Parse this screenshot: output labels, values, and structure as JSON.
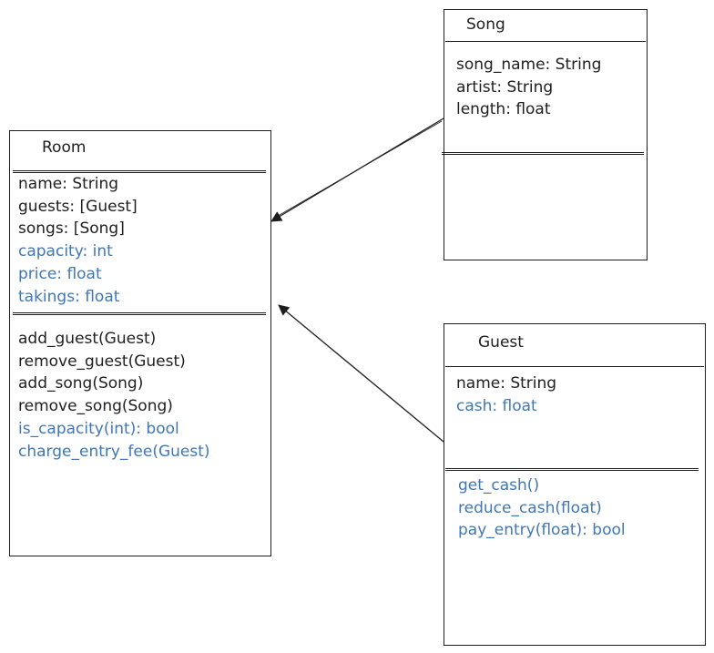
{
  "colors": {
    "ink": "#1e1e1e",
    "accent_blue": "#3f77b4",
    "background": "#ffffff"
  },
  "classes": {
    "room": {
      "title": "Room",
      "attributes": [
        {
          "text": "name: String",
          "color": "black"
        },
        {
          "text": "guests: [Guest]",
          "color": "black"
        },
        {
          "text": "songs: [Song]",
          "color": "black"
        },
        {
          "text": "capacity: int",
          "color": "blue"
        },
        {
          "text": "price: float",
          "color": "blue"
        },
        {
          "text": "takings: float",
          "color": "blue"
        }
      ],
      "methods": [
        {
          "text": "add_guest(Guest)",
          "color": "black"
        },
        {
          "text": "remove_guest(Guest)",
          "color": "black"
        },
        {
          "text": "add_song(Song)",
          "color": "black"
        },
        {
          "text": "remove_song(Song)",
          "color": "black"
        },
        {
          "text": "is_capacity(int): bool",
          "color": "blue"
        },
        {
          "text": "charge_entry_fee(Guest)",
          "color": "blue"
        }
      ]
    },
    "song": {
      "title": "Song",
      "attributes": [
        {
          "text": "song_name: String",
          "color": "black"
        },
        {
          "text": "artist: String",
          "color": "black"
        },
        {
          "text": "length: float",
          "color": "black"
        }
      ],
      "methods": []
    },
    "guest": {
      "title": "Guest",
      "attributes": [
        {
          "text": "name: String",
          "color": "black"
        },
        {
          "text": "cash: float",
          "color": "blue"
        }
      ],
      "methods": [
        {
          "text": "get_cash()",
          "color": "blue"
        },
        {
          "text": "reduce_cash(float)",
          "color": "blue"
        },
        {
          "text": "pay_entry(float): bool",
          "color": "blue"
        }
      ]
    }
  },
  "relations": [
    {
      "from": "song",
      "to": "room",
      "type": "arrow"
    },
    {
      "from": "guest",
      "to": "room",
      "type": "arrow"
    }
  ]
}
